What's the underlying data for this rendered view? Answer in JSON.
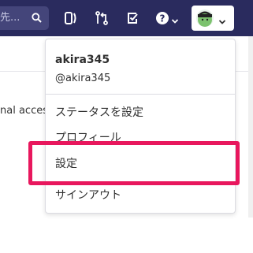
{
  "navbar": {
    "search_placeholder": "先...",
    "icons": [
      "search-icon",
      "issues-icon",
      "merge-request-icon",
      "todo-icon",
      "help-icon",
      "chevron-down-icon"
    ]
  },
  "page": {
    "partial_text": "nal access"
  },
  "user_menu": {
    "name": "akira345",
    "handle": "@akira345",
    "items": [
      {
        "label": "ステータスを設定"
      },
      {
        "label": "プロフィール"
      },
      {
        "label": "設定"
      },
      {
        "label": "サインアウト"
      }
    ]
  },
  "colors": {
    "navbar_bg": "#2a2b5e",
    "highlight": "#e8175d"
  }
}
